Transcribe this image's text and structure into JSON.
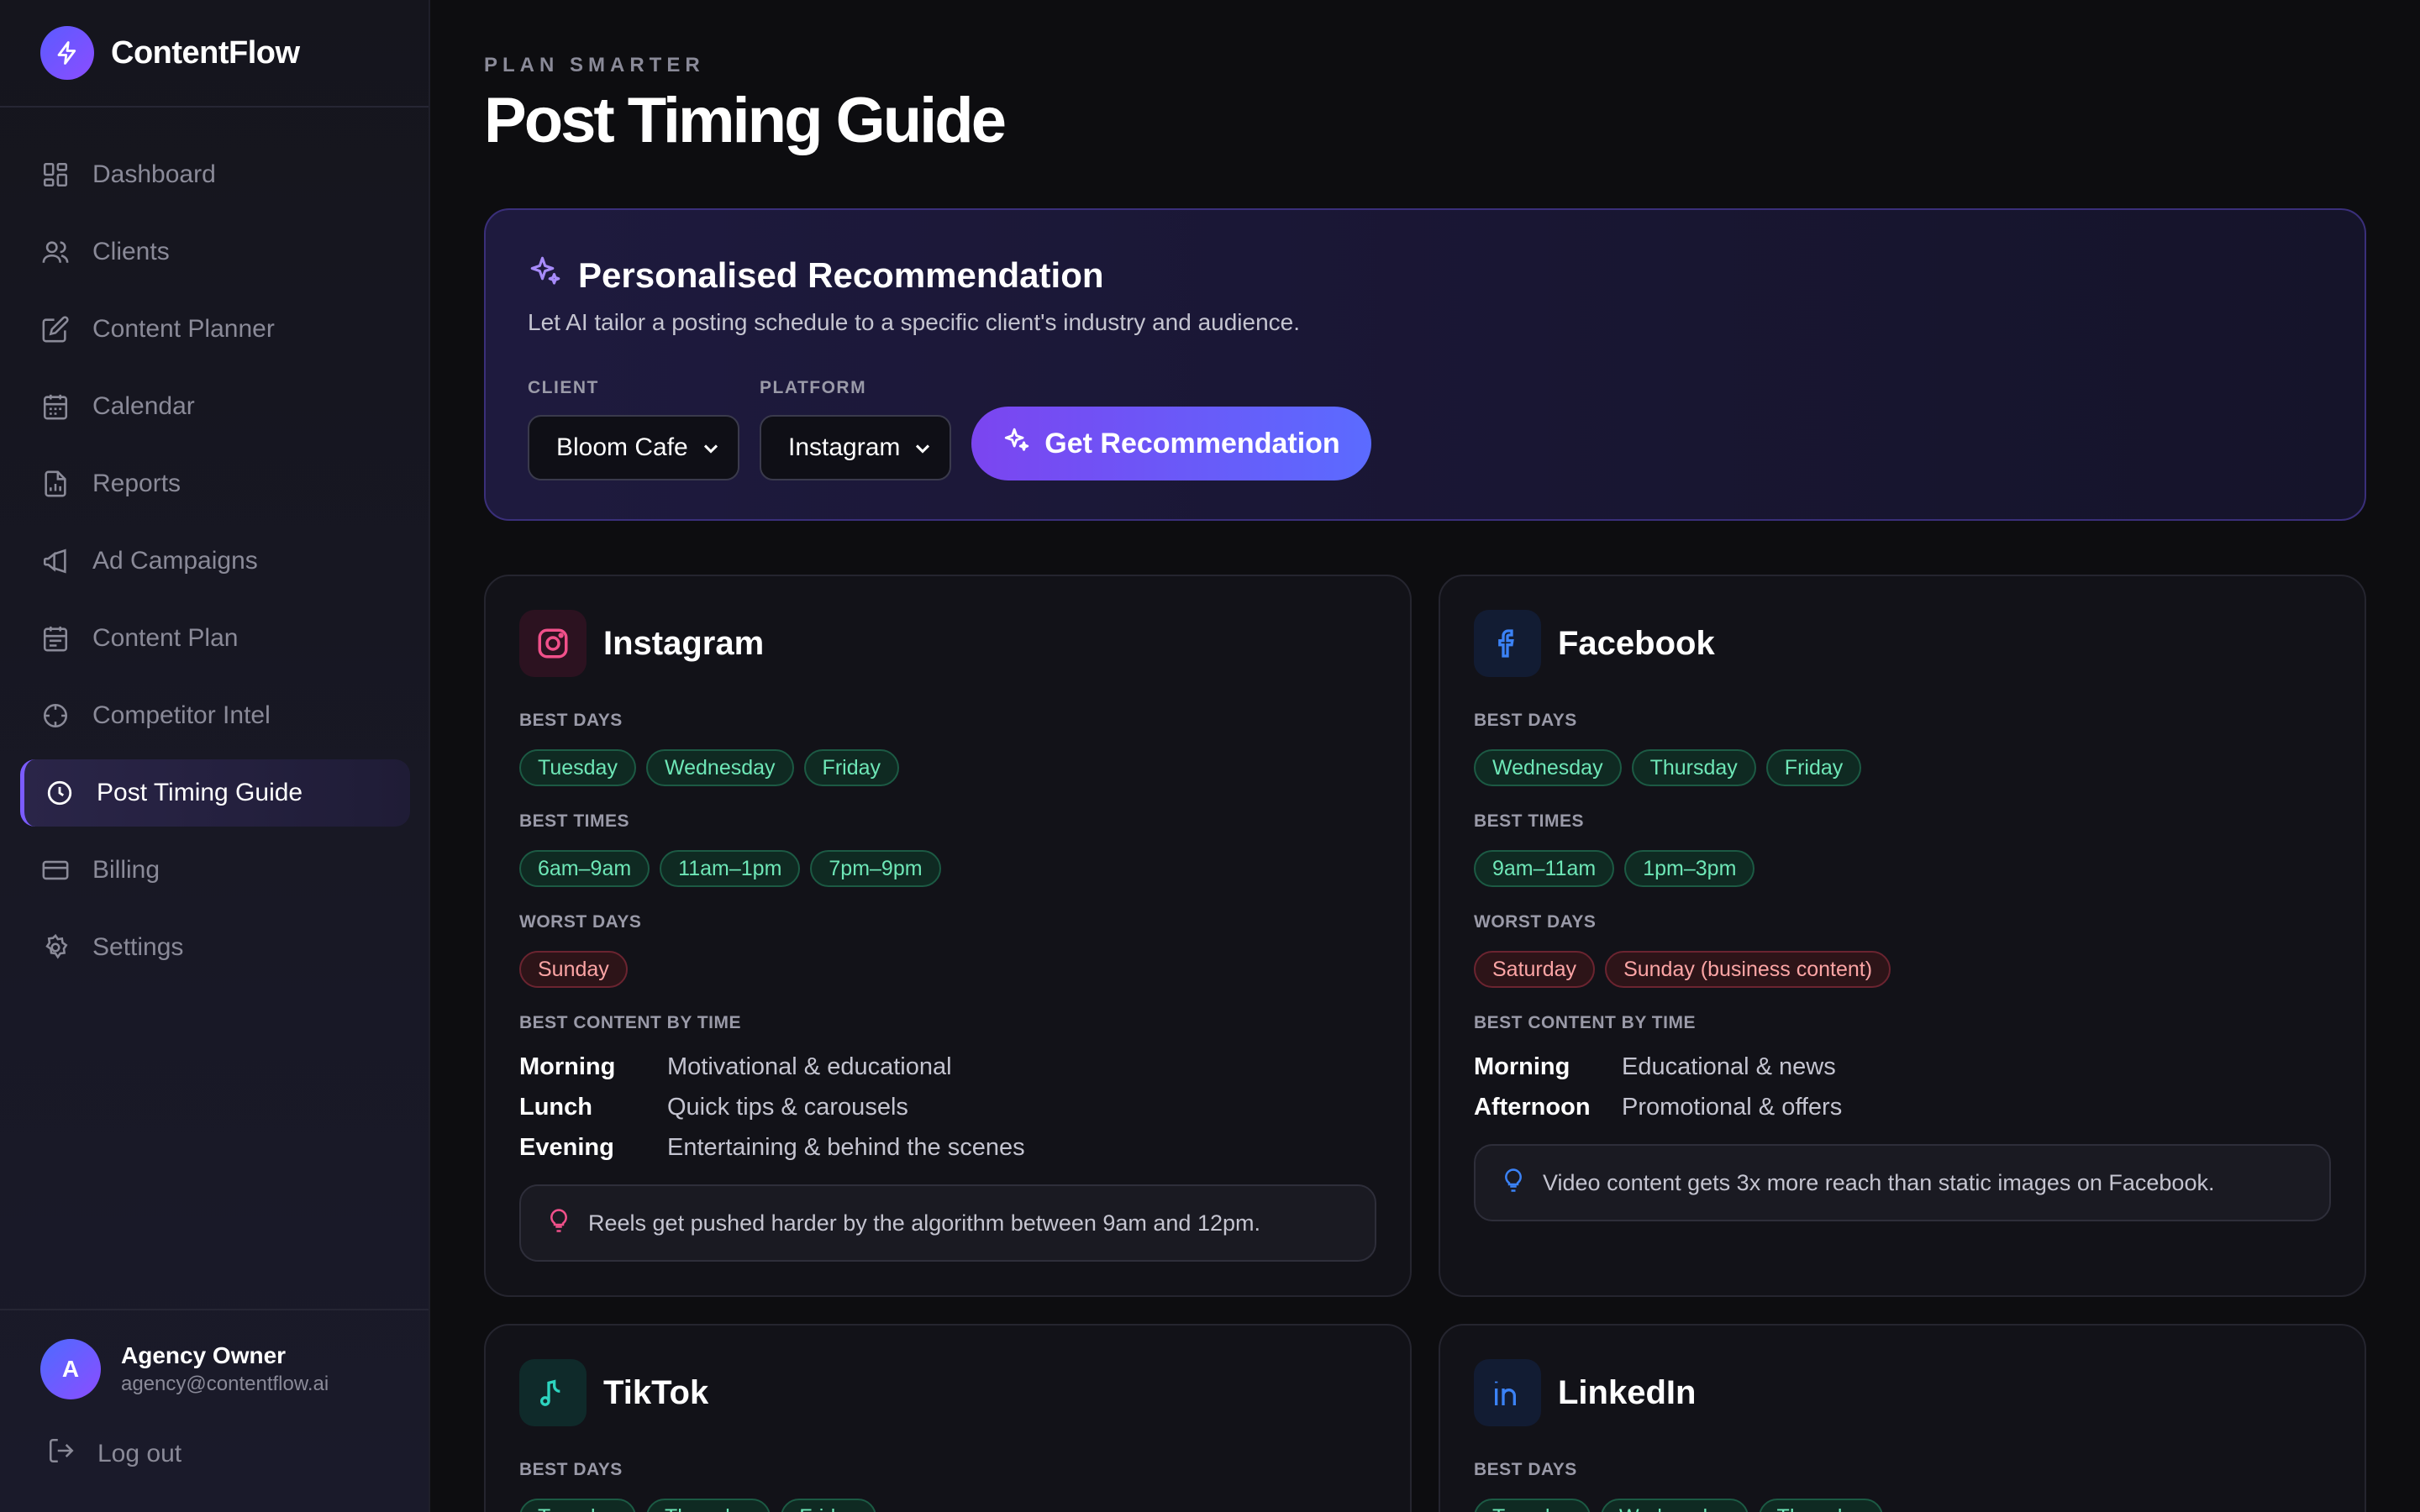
{
  "brand": {
    "name": "ContentFlow"
  },
  "nav": [
    {
      "label": "Dashboard",
      "icon": "grid-icon"
    },
    {
      "label": "Clients",
      "icon": "users-icon"
    },
    {
      "label": "Content Planner",
      "icon": "edit-icon"
    },
    {
      "label": "Calendar",
      "icon": "calendar-icon"
    },
    {
      "label": "Reports",
      "icon": "file-chart-icon"
    },
    {
      "label": "Ad Campaigns",
      "icon": "megaphone-icon"
    },
    {
      "label": "Content Plan",
      "icon": "calendar-list-icon"
    },
    {
      "label": "Competitor Intel",
      "icon": "crosshair-icon"
    },
    {
      "label": "Post Timing Guide",
      "icon": "clock-icon",
      "active": true
    },
    {
      "label": "Billing",
      "icon": "credit-card-icon"
    },
    {
      "label": "Settings",
      "icon": "gear-icon"
    }
  ],
  "user": {
    "initial": "A",
    "name": "Agency Owner",
    "email": "agency@contentflow.ai",
    "logout_label": "Log out"
  },
  "header": {
    "eyebrow": "PLAN SMARTER",
    "title": "Post Timing Guide"
  },
  "recommendation": {
    "title": "Personalised Recommendation",
    "subtitle": "Let AI tailor a posting schedule to a specific client's industry and audience.",
    "client_label": "CLIENT",
    "client_value": "Bloom Cafe",
    "platform_label": "PLATFORM",
    "platform_value": "Instagram",
    "button_label": "Get Recommendation"
  },
  "labels": {
    "best_days": "BEST DAYS",
    "best_times": "BEST TIMES",
    "worst_days": "WORST DAYS",
    "best_content": "BEST CONTENT BY TIME"
  },
  "platforms": {
    "instagram": {
      "name": "Instagram",
      "best_days": [
        "Tuesday",
        "Wednesday",
        "Friday"
      ],
      "best_times": [
        "6am–9am",
        "11am–1pm",
        "7pm–9pm"
      ],
      "worst_days": [
        "Sunday"
      ],
      "content": [
        {
          "slot": "Morning",
          "type": "Motivational & educational"
        },
        {
          "slot": "Lunch",
          "type": "Quick tips & carousels"
        },
        {
          "slot": "Evening",
          "type": "Entertaining & behind the scenes"
        }
      ],
      "tip": "Reels get pushed harder by the algorithm between 9am and 12pm.",
      "accent": "#f0508a"
    },
    "facebook": {
      "name": "Facebook",
      "best_days": [
        "Wednesday",
        "Thursday",
        "Friday"
      ],
      "best_times": [
        "9am–11am",
        "1pm–3pm"
      ],
      "worst_days": [
        "Saturday",
        "Sunday (business content)"
      ],
      "content": [
        {
          "slot": "Morning",
          "type": "Educational & news"
        },
        {
          "slot": "Afternoon",
          "type": "Promotional & offers"
        }
      ],
      "tip": "Video content gets 3x more reach than static images on Facebook.",
      "accent": "#3b82f6"
    },
    "tiktok": {
      "name": "TikTok",
      "best_days": [
        "Tuesday",
        "Thursday",
        "Friday"
      ],
      "accent": "#2dd4bf"
    },
    "linkedin": {
      "name": "LinkedIn",
      "best_days": [
        "Tuesday",
        "Wednesday",
        "Thursday"
      ],
      "accent": "#3b82f6"
    }
  }
}
